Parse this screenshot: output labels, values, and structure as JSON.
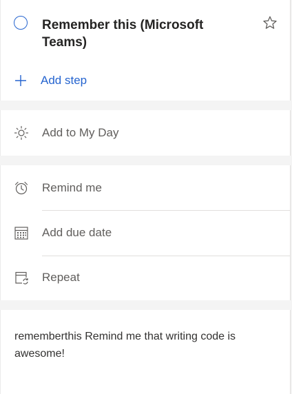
{
  "task": {
    "title": "Remember this (Microsoft Teams)",
    "add_step_label": "Add step",
    "accent_color": "#2564cf"
  },
  "my_day": {
    "label": "Add to My Day",
    "icon": "sun-icon"
  },
  "dates": {
    "remind": {
      "label": "Remind me",
      "icon": "alarm-clock-icon"
    },
    "due": {
      "label": "Add due date",
      "icon": "calendar-icon"
    },
    "repeat": {
      "label": "Repeat",
      "icon": "repeat-calendar-icon"
    }
  },
  "note": {
    "text": "rememberthis Remind me that writing code is awesome!"
  }
}
